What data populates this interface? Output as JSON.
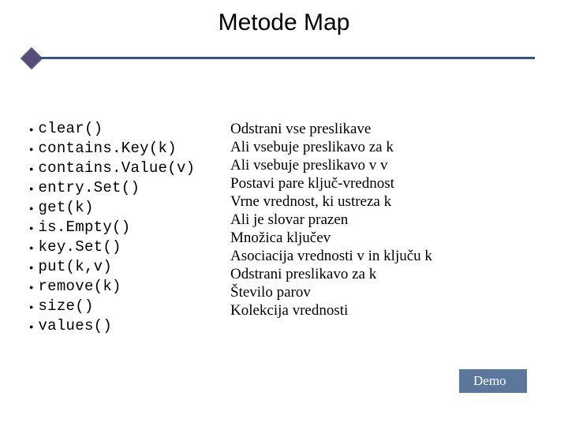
{
  "title": "Metode Map",
  "methods": [
    {
      "name": "clear()",
      "desc": "Odstrani vse preslikave"
    },
    {
      "name": "contains.Key(k)",
      "desc": "Ali vsebuje preslikavo za k"
    },
    {
      "name": "contains.Value(v)",
      "desc": "Ali vsebuje preslikavo v  v"
    },
    {
      "name": "entry.Set()",
      "desc": "Postavi pare ključ-vrednost"
    },
    {
      "name": "get(k)",
      "desc": "Vrne vrednost, ki ustreza k"
    },
    {
      "name": "is.Empty()",
      "desc": "Ali je slovar prazen"
    },
    {
      "name": "key.Set()",
      "desc": "Množica ključev"
    },
    {
      "name": "put(k,v)",
      "desc": "Asociacija vrednosti v in ključu k"
    },
    {
      "name": "remove(k)",
      "desc": "Odstrani preslikavo za k"
    },
    {
      "name": "size()",
      "desc": "Število parov"
    },
    {
      "name": "values()",
      "desc": "Kolekcija vrednosti"
    }
  ],
  "demo_label": "Demo"
}
